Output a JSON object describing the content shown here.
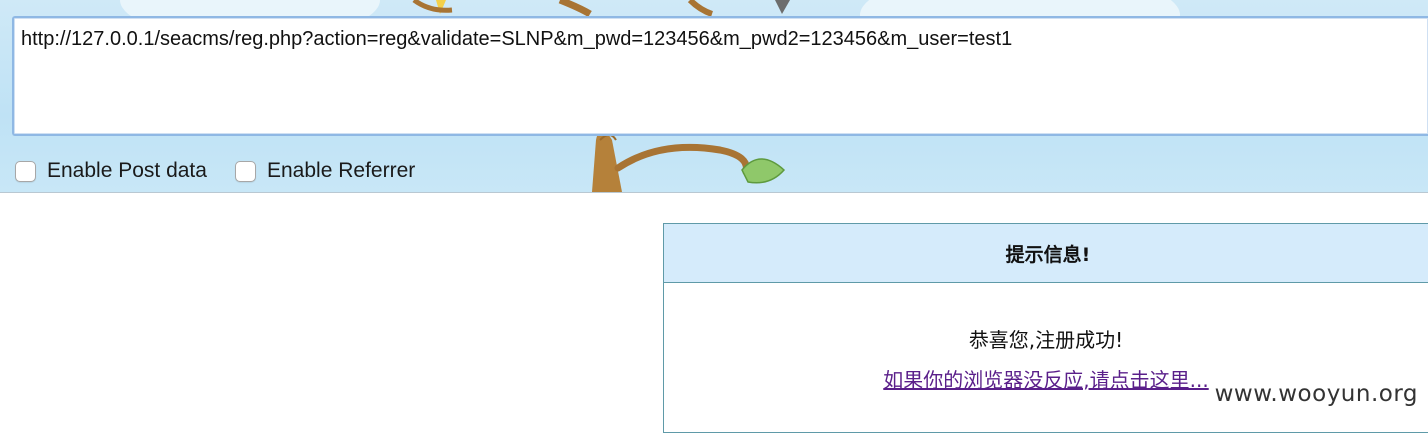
{
  "toolbar": {
    "url_value": "http://127.0.0.1/seacms/reg.php?action=reg&validate=SLNP&m_pwd=123456&m_pwd2=123456&m_user=test1",
    "enable_post_label": "Enable Post data",
    "enable_referrer_label": "Enable Referrer",
    "enable_post_checked": false,
    "enable_referrer_checked": false
  },
  "message": {
    "title": "提示信息!",
    "text": "恭喜您,注册成功!",
    "link": "如果你的浏览器没反应,请点击这里..."
  },
  "watermark": "www.wooyun.org",
  "colors": {
    "sky": "#c8e7f7",
    "url_border": "#8fb8e4",
    "msg_header_bg": "#d5ebfb",
    "msg_border": "#5f9aa8",
    "link": "#5a1f8a"
  }
}
